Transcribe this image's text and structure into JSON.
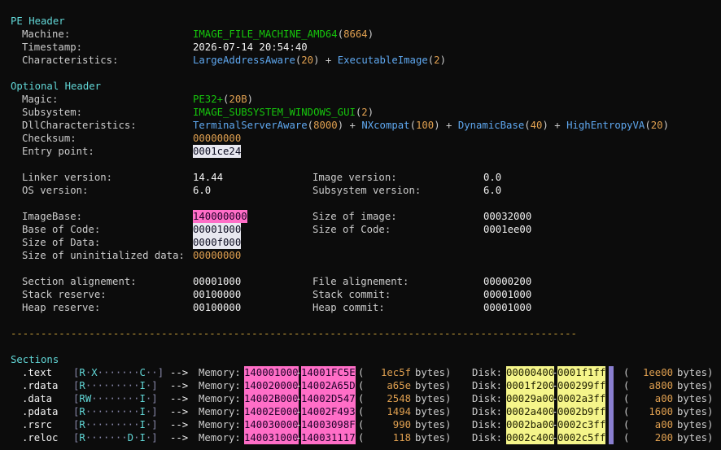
{
  "top_fragment": "I",
  "pe_header": {
    "title": "PE Header",
    "machine_label": "Machine:",
    "machine_value": "IMAGE_FILE_MACHINE_AMD64",
    "machine_code": "8664",
    "timestamp_label": "Timestamp:",
    "timestamp_value": "2026-07-14 20:54:40",
    "characteristics_label": "Characteristics:",
    "char1_name": "LargeAddressAware",
    "char1_val": "20",
    "char2_name": "ExecutableImage",
    "char2_val": "2"
  },
  "optional_header": {
    "title": "Optional Header",
    "magic_label": "Magic:",
    "magic_value": "PE32+",
    "magic_code": "20B",
    "subsystem_label": "Subsystem:",
    "subsystem_value": "IMAGE_SUBSYSTEM_WINDOWS_GUI",
    "subsystem_code": "2",
    "dll_label": "DllCharacteristics:",
    "dll1_name": "TerminalServerAware",
    "dll1_val": "8000",
    "dll2_name": "NXcompat",
    "dll2_val": "100",
    "dll3_name": "DynamicBase",
    "dll3_val": "40",
    "dll4_name": "HighEntropyVA",
    "dll4_val": "20",
    "checksum_label": "Checksum:",
    "checksum_value": "00000000",
    "entry_label": "Entry point:",
    "entry_value": "0001ce24",
    "linker_label": "Linker version:",
    "linker_value": "14.44",
    "image_ver_label": "Image version:",
    "image_ver_value": "0.0",
    "os_label": "OS version:",
    "os_value": "6.0",
    "subsys_ver_label": "Subsystem version:",
    "subsys_ver_value": "6.0",
    "imagebase_label": "ImageBase:",
    "imagebase_value": "140000000",
    "size_image_label": "Size of image:",
    "size_image_value": "00032000",
    "base_code_label": "Base of Code:",
    "base_code_value": "00001000",
    "size_code_label": "Size of Code:",
    "size_code_value": "0001ee00",
    "size_data_label": "Size of Data:",
    "size_data_value": "0000f000",
    "size_uninit_label": "Size of uninitialized data:",
    "size_uninit_value": "00000000",
    "section_align_label": "Section alignement:",
    "section_align_value": "00001000",
    "file_align_label": "File alignement:",
    "file_align_value": "00000200",
    "stack_res_label": "Stack reserve:",
    "stack_res_value": "00100000",
    "stack_commit_label": "Stack commit:",
    "stack_commit_value": "00001000",
    "heap_res_label": "Heap reserve:",
    "heap_res_value": "00100000",
    "heap_commit_label": "Heap commit:",
    "heap_commit_value": "00001000"
  },
  "separator": "----------------------------------------------------------------------------------------------",
  "sections": {
    "title": "Sections",
    "arrow": "-->",
    "memory_label": "Memory:",
    "disk_label": "Disk:",
    "bytes_label": "bytes)",
    "open_paren": "(",
    "dash": "-",
    "rows": [
      {
        "name": ".text",
        "perms": "[R·X·······C··]",
        "mem_start": "140001000",
        "mem_end": "14001FC5E",
        "mem_bytes": "1ec5f",
        "disk_start": "00000400",
        "disk_end": "0001f1ff",
        "disk_bytes": "1ee00"
      },
      {
        "name": ".rdata",
        "perms": "[R·········I·]",
        "mem_start": "140020000",
        "mem_end": "14002A65D",
        "mem_bytes": "a65e",
        "disk_start": "0001f200",
        "disk_end": "000299ff",
        "disk_bytes": "a800"
      },
      {
        "name": ".data",
        "perms": "[RW········I·]",
        "mem_start": "14002B000",
        "mem_end": "14002D547",
        "mem_bytes": "2548",
        "disk_start": "00029a00",
        "disk_end": "0002a3ff",
        "disk_bytes": "a00"
      },
      {
        "name": ".pdata",
        "perms": "[R·········I·]",
        "mem_start": "14002E000",
        "mem_end": "14002F493",
        "mem_bytes": "1494",
        "disk_start": "0002a400",
        "disk_end": "0002b9ff",
        "disk_bytes": "1600"
      },
      {
        "name": ".rsrc",
        "perms": "[R·········I·]",
        "mem_start": "140030000",
        "mem_end": "14003098F",
        "mem_bytes": "990",
        "disk_start": "0002ba00",
        "disk_end": "0002c3ff",
        "disk_bytes": "a00"
      },
      {
        "name": ".reloc",
        "perms": "[R·······D·I·]",
        "mem_start": "140031000",
        "mem_end": "140031117",
        "mem_bytes": "118",
        "disk_start": "0002c400",
        "disk_end": "0002c5ff",
        "disk_bytes": "200"
      }
    ]
  }
}
